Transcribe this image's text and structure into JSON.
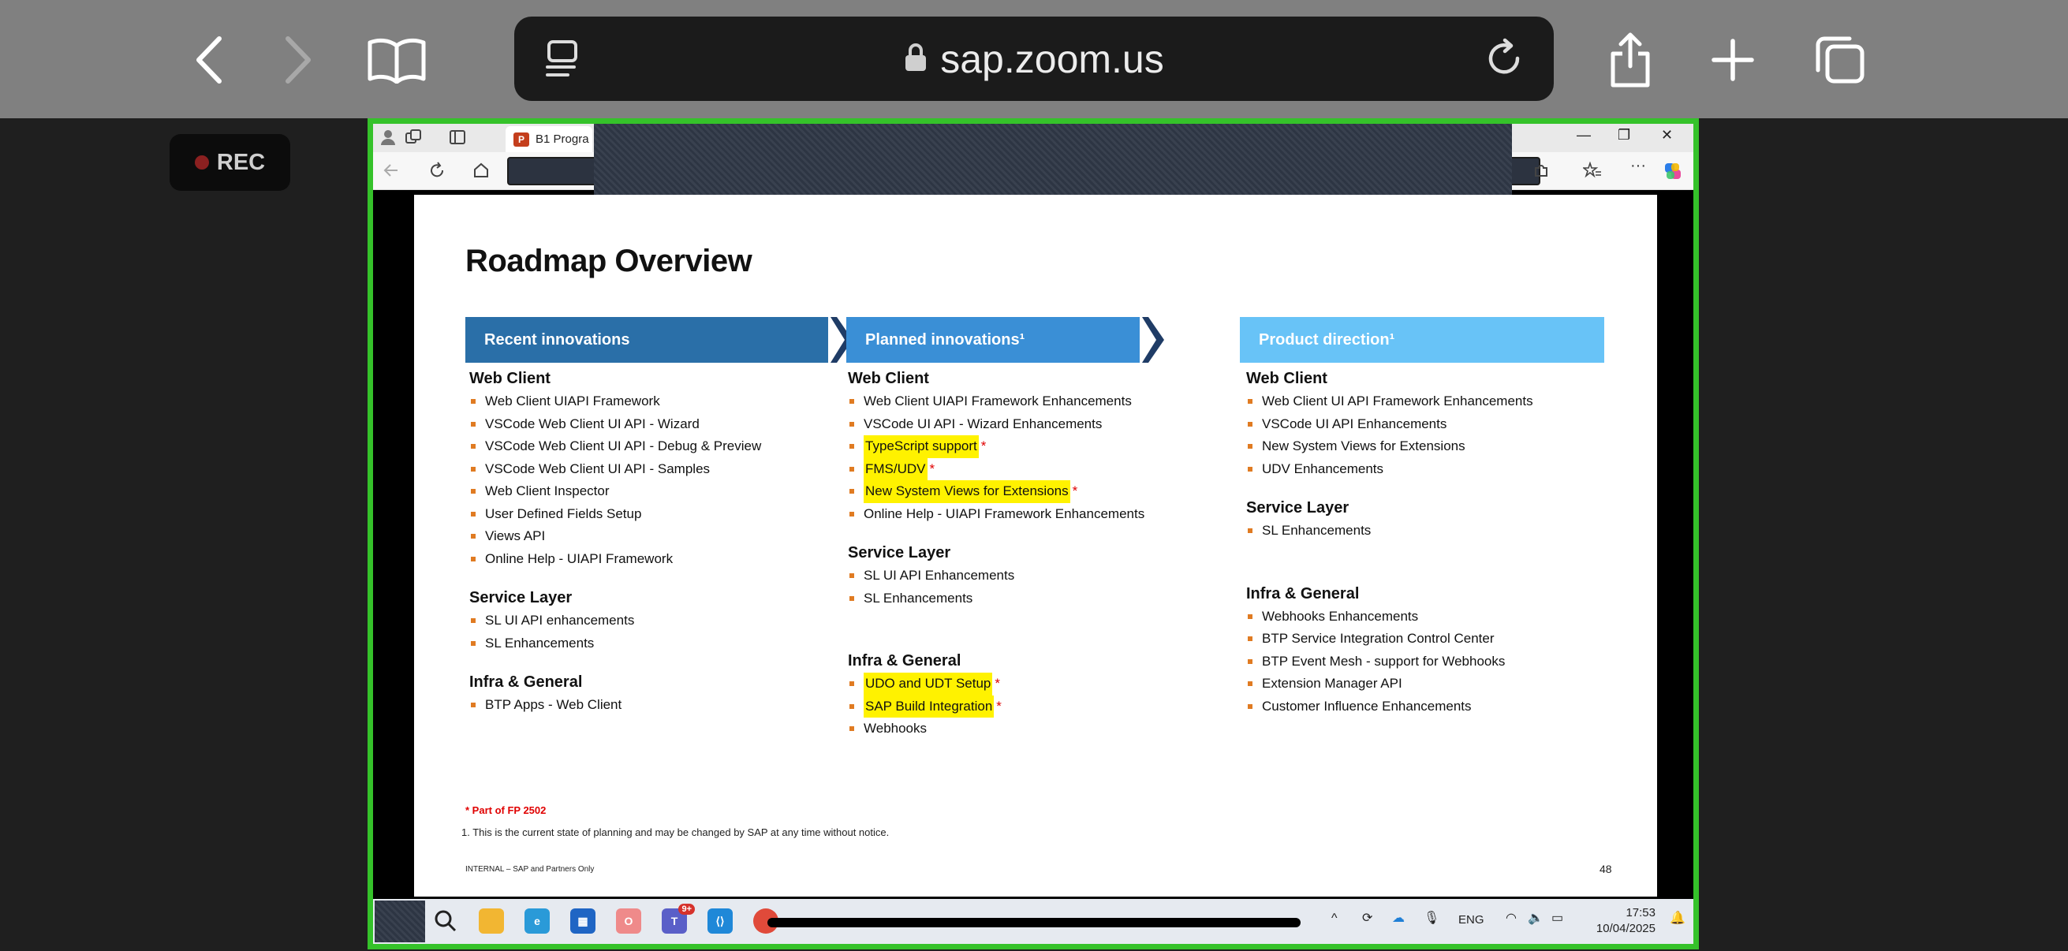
{
  "safari": {
    "url": "sap.zoom.us",
    "icons": [
      "back-icon",
      "forward-icon",
      "bookmarks-icon",
      "tabs-overview-icon",
      "lock-icon",
      "reload-icon",
      "share-icon",
      "new-tab-icon",
      "tab-switcher-icon"
    ]
  },
  "recording": {
    "label": "REC"
  },
  "edge": {
    "tab_title": "B1 Progra",
    "icons": [
      "profile-icon",
      "workspaces-icon",
      "tab-actions-icon",
      "back-icon",
      "refresh-icon",
      "home-icon",
      "extensions-icon",
      "favorites-icon",
      "more-icon",
      "copilot-icon"
    ]
  },
  "slide": {
    "title": "Roadmap Overview",
    "columns": [
      {
        "header": "Recent innovations",
        "sections": [
          {
            "title": "Web Client",
            "items": [
              {
                "text": "Web Client UIAPI Framework"
              },
              {
                "text": "VSCode Web Client UI API - Wizard"
              },
              {
                "text": "VSCode Web Client UI API - Debug & Preview"
              },
              {
                "text": "VSCode Web Client UI API - Samples"
              },
              {
                "text": "Web Client Inspector"
              },
              {
                "text": "User Defined Fields Setup"
              },
              {
                "text": "Views API"
              },
              {
                "text": "Online Help - UIAPI Framework"
              }
            ]
          },
          {
            "title": "Service Layer",
            "items": [
              {
                "text": "SL UI API enhancements"
              },
              {
                "text": "SL Enhancements"
              }
            ]
          },
          {
            "title": "Infra & General",
            "items": [
              {
                "text": "BTP Apps - Web Client"
              }
            ]
          }
        ]
      },
      {
        "header": "Planned innovations¹",
        "sections": [
          {
            "title": "Web Client",
            "items": [
              {
                "text": "Web Client UIAPI Framework Enhancements"
              },
              {
                "text": "VSCode UI API - Wizard Enhancements"
              },
              {
                "text": "TypeScript support",
                "highlight": true,
                "star": "*"
              },
              {
                "text": "FMS/UDV",
                "highlight": true,
                "star": "*"
              },
              {
                "text": "New System Views for Extensions",
                "highlight": true,
                "star": "*"
              },
              {
                "text": "Online Help - UIAPI Framework Enhancements"
              }
            ]
          },
          {
            "title": "Service Layer",
            "items": [
              {
                "text": "SL UI API Enhancements"
              },
              {
                "text": "SL Enhancements"
              }
            ]
          },
          {
            "title": "Infra & General",
            "items": [
              {
                "text": "UDO and UDT Setup",
                "highlight": true,
                "star": "*"
              },
              {
                "text": "SAP Build Integration",
                "highlight": true,
                "star": "*"
              },
              {
                "text": "Webhooks"
              }
            ]
          }
        ]
      },
      {
        "header": "Product direction¹",
        "sections": [
          {
            "title": "Web Client",
            "items": [
              {
                "text": "Web Client UI API Framework Enhancements"
              },
              {
                "text": "VSCode UI API Enhancements"
              },
              {
                "text": "New System Views for Extensions"
              },
              {
                "text": "UDV Enhancements"
              }
            ]
          },
          {
            "title": "Service Layer",
            "items": [
              {
                "text": "SL Enhancements"
              }
            ]
          },
          {
            "title": "Infra & General",
            "items": [
              {
                "text": "Webhooks Enhancements"
              },
              {
                "text": "BTP Service Integration Control Center"
              },
              {
                "text": "BTP Event Mesh - support for Webhooks"
              },
              {
                "text": "Extension Manager API"
              },
              {
                "text": "Customer Influence Enhancements"
              }
            ]
          }
        ]
      }
    ],
    "footnote_marker": "* Part of FP 2502",
    "footnote": "1. This is the current state of planning and may be changed by SAP at any time without notice.",
    "classification": "INTERNAL – SAP and Partners Only",
    "page_number": "48"
  },
  "taskbar": {
    "icons": [
      "search-icon",
      "file-explorer-icon",
      "edge-icon",
      "store-icon",
      "outlook-icon",
      "teams-icon",
      "vscode-icon",
      "chrome-icon"
    ],
    "teams_badge": "9+",
    "language": "ENG",
    "time": "17:53",
    "date": "10/04/2025"
  },
  "colors": {
    "header_recent": "#2a6fa8",
    "header_planned": "#3a8fd6",
    "header_direction": "#68c3f7",
    "bullet": "#e07b22",
    "highlight": "#fff200",
    "share_border": "#35c22a"
  }
}
